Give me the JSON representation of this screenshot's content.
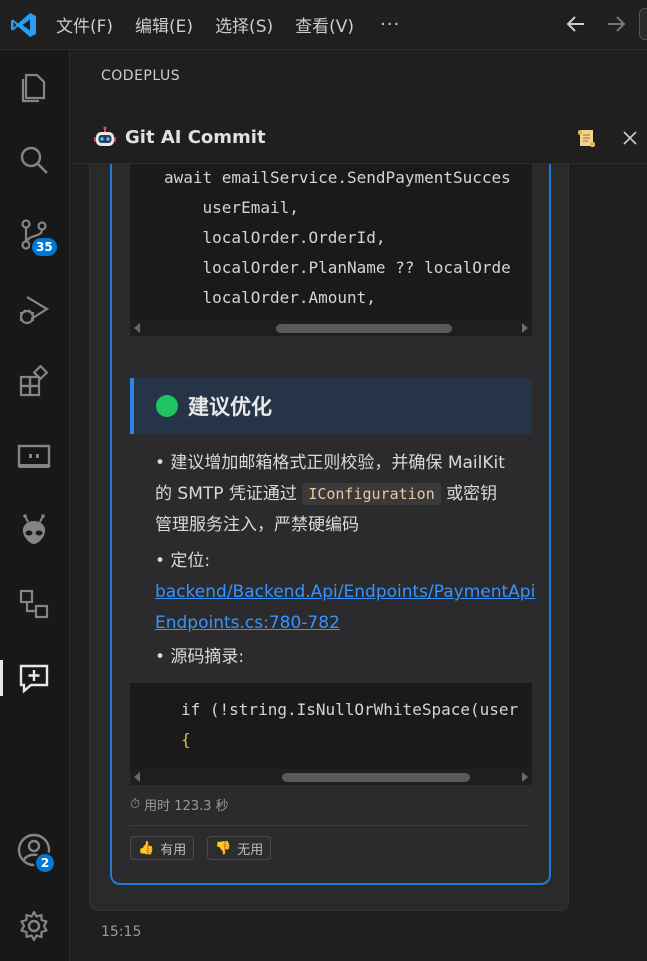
{
  "menu": {
    "items": [
      "文件(F)",
      "编辑(E)",
      "选择(S)",
      "查看(V)"
    ],
    "more": "···"
  },
  "activity_bar": {
    "icons": [
      "explorer-icon",
      "search-icon",
      "source-control-icon",
      "run-debug-icon",
      "extensions-icon",
      "remote-explorer-icon",
      "alien-icon",
      "diagram-icon",
      "chat-plus-icon",
      "account-icon",
      "settings-icon"
    ],
    "source_control_badge": "35",
    "account_badge": "2"
  },
  "panel": {
    "title": "CODEPLUS",
    "header_title": "Git AI Commit"
  },
  "message": {
    "code_block_1": {
      "lines": [
        "await emailService.SendPaymentSucces",
        "    userEmail,",
        "    localOrder.OrderId,",
        "    localOrder.PlanName ?? localOrde",
        "    localOrder.Amount,"
      ]
    },
    "section_title": "建议优化",
    "bullet_1_line_1": "• 建议增加邮箱格式正则校验，并确保 MailKit",
    "bullet_1_line_2_a": "的 SMTP 凭证通过 ",
    "bullet_1_code": "IConfiguration",
    "bullet_1_line_2_b": " 或密钥",
    "bullet_1_line_3": "管理服务注入，严禁硬编码",
    "bullet_2_label": "• 定位:",
    "location_link_line_1": "backend/Backend.Api/Endpoints/PaymentApi",
    "location_link_line_2": "Endpoints.cs:780-782",
    "bullet_3_label": "• 源码摘录:",
    "code_block_2": {
      "lines": [
        "if (!string.IsNullOrWhiteSpace(user",
        "{"
      ]
    },
    "timing_icon": "⏱",
    "timing": "用时 123.3 秒",
    "useful_icon": "👍",
    "useful_label": "有用",
    "useless_icon": "👎",
    "useless_label": "无用",
    "timestamp": "15:15"
  },
  "colors": {
    "accent": "#1f7ad8",
    "badge": "#0078d4",
    "green_dot": "#1dc45f",
    "link": "#3794ff"
  }
}
